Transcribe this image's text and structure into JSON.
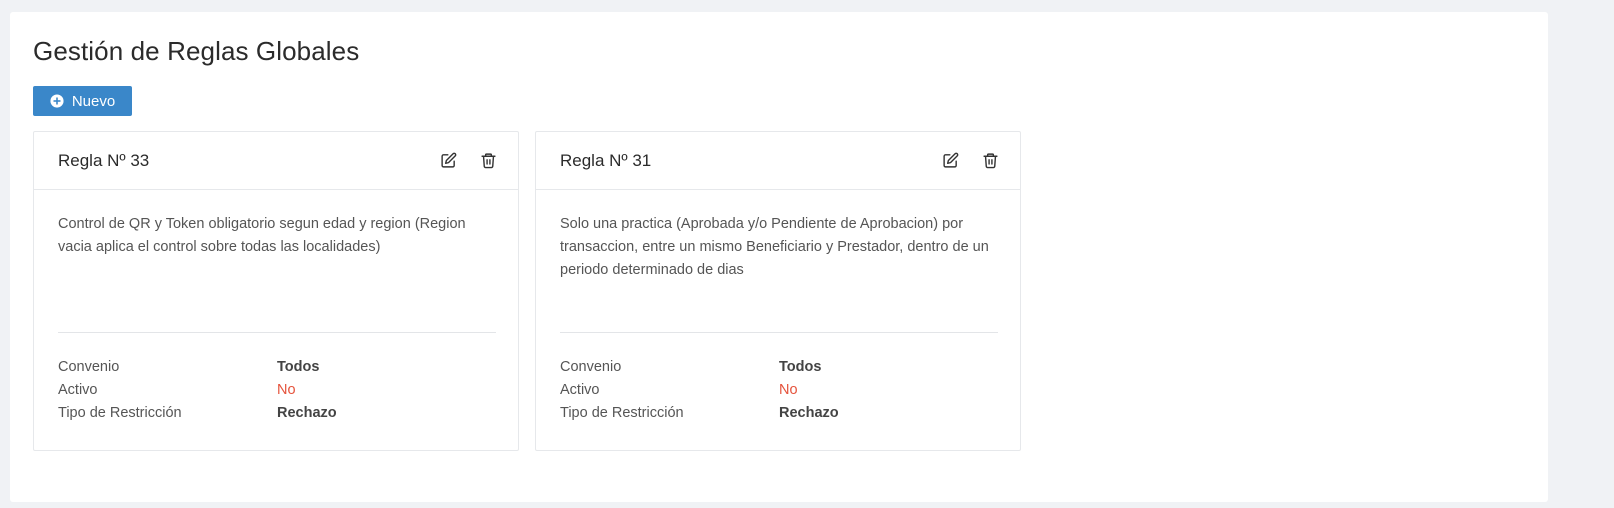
{
  "page": {
    "title": "Gestión de Reglas Globales",
    "new_button_label": "Nuevo"
  },
  "colors": {
    "primary": "#3a87c9",
    "danger": "#e5533c",
    "background": "#f0f2f5"
  },
  "icons": {
    "new": "plus-circle-icon",
    "edit": "edit-icon",
    "delete": "trash-icon"
  },
  "rules": [
    {
      "title": "Regla Nº 33",
      "description": "Control de QR y Token obligatorio segun edad y region (Region vacia aplica el control sobre todas las localidades)",
      "attributes": [
        {
          "label": "Convenio",
          "value": "Todos",
          "status": "normal"
        },
        {
          "label": "Activo",
          "value": "No",
          "status": "danger"
        },
        {
          "label": "Tipo de Restricción",
          "value": "Rechazo",
          "status": "normal"
        }
      ]
    },
    {
      "title": "Regla Nº 31",
      "description": "Solo una practica (Aprobada y/o Pendiente de Aprobacion) por transaccion, entre un mismo Beneficiario y Prestador, dentro de un periodo determinado de dias",
      "attributes": [
        {
          "label": "Convenio",
          "value": "Todos",
          "status": "normal"
        },
        {
          "label": "Activo",
          "value": "No",
          "status": "danger"
        },
        {
          "label": "Tipo de Restricción",
          "value": "Rechazo",
          "status": "normal"
        }
      ]
    }
  ]
}
